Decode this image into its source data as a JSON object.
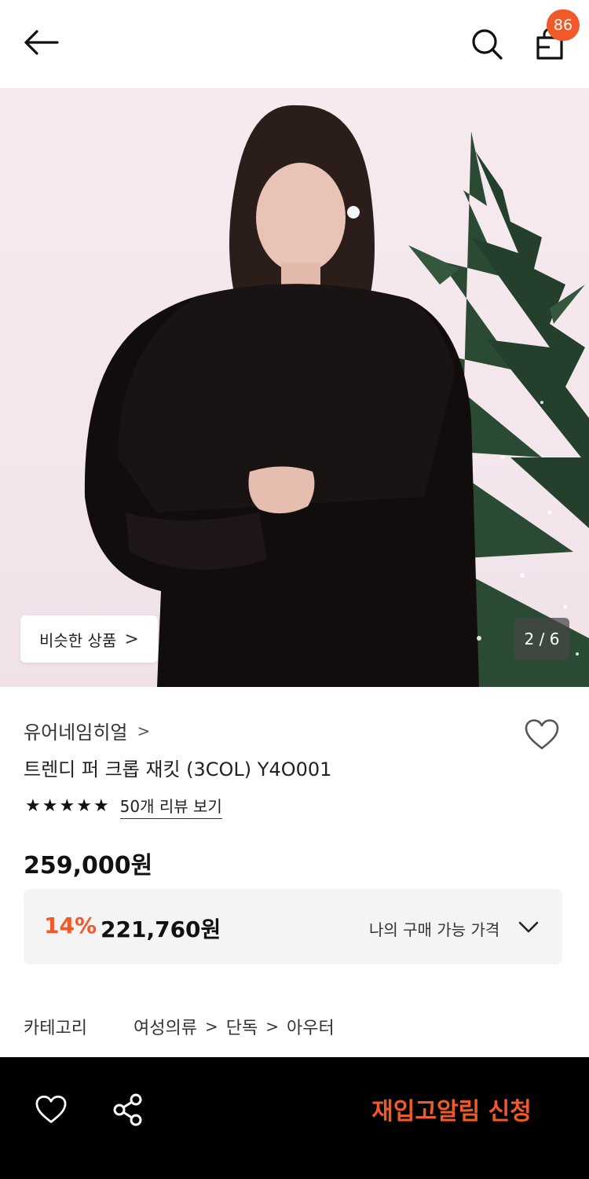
{
  "topbar": {
    "cart_count": "86",
    "icons": [
      "arrow-left-icon",
      "search-icon",
      "shopping-bag-icon"
    ]
  },
  "gallery": {
    "similar_label": "비슷한 상품",
    "similar_chevron": ">",
    "indicator": "2 / 6"
  },
  "product": {
    "brand": "유어네임히얼",
    "brand_chevron": ">",
    "title": "트렌디 퍼 크롭 재킷 (3COL) Y4O001",
    "rating_stars": 5,
    "stars_text": [
      "★",
      "★",
      "★",
      "★",
      "★"
    ],
    "review_link": "50개 리뷰 보기",
    "price": "259,000원"
  },
  "discount": {
    "rate": "14%",
    "price": "221,760원",
    "label": "나의 구매 가능 가격"
  },
  "category": {
    "label": "카테고리",
    "path": [
      "여성의류",
      "단독",
      "아우터"
    ],
    "separator": ">"
  },
  "bottombar": {
    "restock_label": "재입고알림 신청"
  },
  "colors": {
    "accent": "#f05a28",
    "bottom_bar": "#000000",
    "discount_bg": "#f4f4f5"
  }
}
